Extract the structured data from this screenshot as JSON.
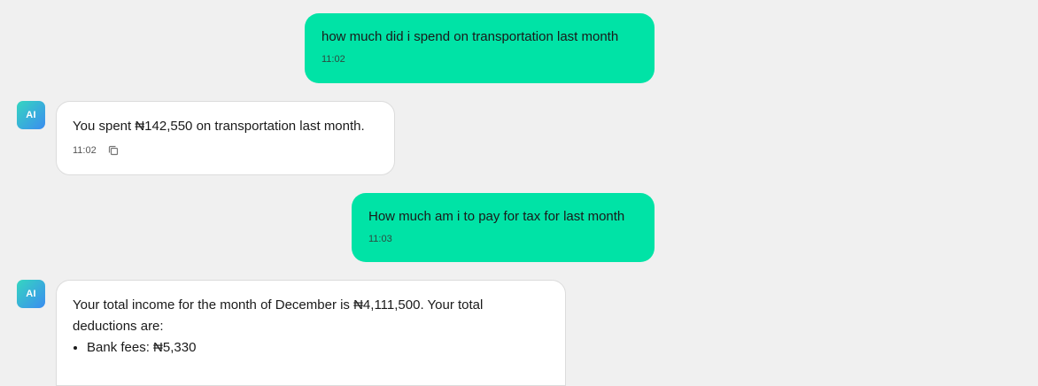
{
  "messages": {
    "user1": {
      "text": "how much did i spend on transportation last month",
      "time": "11:02"
    },
    "ai1": {
      "avatar": "AI",
      "text": "You spent ₦142,550 on transportation last month.",
      "time": "11:02",
      "copy_icon": "copy-icon"
    },
    "user2": {
      "text": "How much am i to pay for tax for last month",
      "time": "11:03"
    },
    "ai2": {
      "avatar": "AI",
      "text": "Your total income for the month of December is ₦4,111,500. Your total deductions are:",
      "deductions": [
        "Bank fees: ₦5,330"
      ]
    }
  },
  "colors": {
    "background": "#f0f0f0",
    "user_bubble": "#00e3a6",
    "ai_bubble": "#ffffff",
    "avatar_gradient_start": "#35d6c0",
    "avatar_gradient_end": "#3b8cf0"
  }
}
